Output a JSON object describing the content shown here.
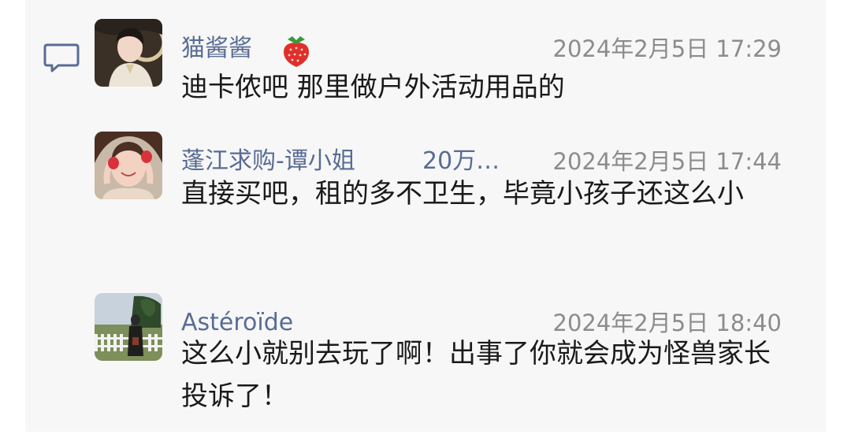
{
  "comments": [
    {
      "name": "猫酱酱",
      "name_icon": "strawberry-icon",
      "time": "2024年2月5日 17:29",
      "text": "迪卡侬吧 那里做户外活动用品的"
    },
    {
      "name": "蓬江求购-谭小姐",
      "badge": "20万…",
      "time": "2024年2月5日 17:44",
      "text": "直接买吧，租的多不卫生，毕竟小孩子还这么小"
    },
    {
      "name": "Astéroïde",
      "time": "2024年2月5日 18:40",
      "text": "这么小就别去玩了啊！出事了你就会成为怪兽家长投诉了！"
    }
  ],
  "icons": {
    "comment": "comment-bubble-icon"
  },
  "colors": {
    "name": "#586c94",
    "time": "#8c8c8c",
    "text": "#1a1a1a",
    "panel_bg": "#f7f7f7"
  }
}
